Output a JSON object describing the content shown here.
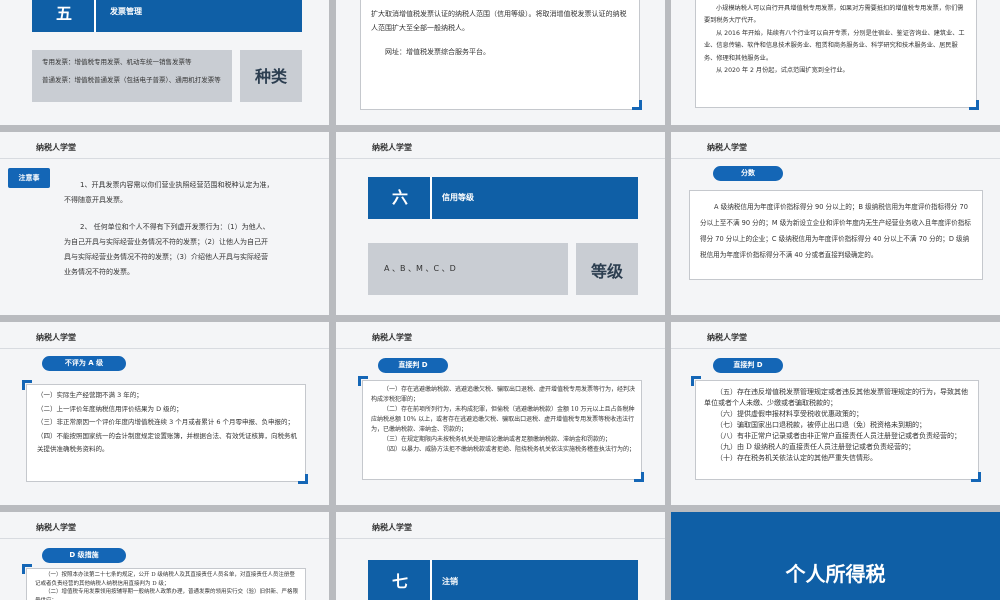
{
  "s1": {
    "number": "五",
    "title": "发票管理",
    "lines": [
      "专用发票：增值税专用发票、机动车统一销售发票等",
      "普通发票：增值税普通发票（包括电子普票）、通用机打发票等"
    ],
    "label": "种类"
  },
  "s2": {
    "p1": "扩大取消增值税发票认证的纳税人范围（信用等级）。将取消增值税发票认证的纳税人范围扩大至全部一般纳税人。",
    "p2": "网址：增值税发票综合服务平台。"
  },
  "s3": {
    "lines": [
      "小规模纳税人可以自行开具增值税专用发票，如果对方需要抵扣的增值税专用发票，你们需要到税务大厅代开。",
      "从 2016 年开始，陆续有八个行业可以自开专票，分别是住宿业、鉴证咨询业、建筑业、工业、信息传输、软件和信息技术服务业、租赁和商务服务业、科学研究和技术服务业、居民服务、修理和其他服务业。",
      "从 2020 年 2 月份起，试点范围扩宽到全行业。"
    ]
  },
  "s4": {
    "header": "纳税人学堂",
    "tag": "注意事",
    "p1": "1、开具发票内容需以你们营业执照经营范围和税种认定为准，不得随意开具发票。",
    "p2": "2、 任何单位和个人不得有下列虚开发票行为：（1）为他人、为自己开具与实际经营业务情况不符的发票；（2）让他人为自己开具与实际经营业务情况不符的发票；（3）介绍他人开具与实际经营业务情况不符的发票。"
  },
  "s5": {
    "header": "纳税人学堂",
    "number": "六",
    "title": "信用等级",
    "grades": "A 、B 、M 、C 、D",
    "label": "等级"
  },
  "s6": {
    "header": "纳税人学堂",
    "pill": "分数",
    "text": "A 级纳税信用为年度评价指标得分 90 分以上的；B 级纳税信用为年度评价指标得分 70 分以上至不满 90 分的；M 级为新设立企业和评价年度内无生产经营业务收入且年度评价指标得分 70 分以上的企业；C 级纳税信用为年度评价指标得分 40 分以上不满 70 分的；D 级纳税信用为年度评价指标得分不满 40 分或者直接判级确定的。"
  },
  "s7": {
    "header": "纳税人学堂",
    "pill": "不评为 A 级",
    "lines": [
      "（一）实际生产经营期不满 3 年的；",
      "（二）上一评价年度纳税信用评价结果为 D 级的；",
      "（三）非正常原因一个评价年度内增值税连续 3 个月或者累计 6 个月零申报、负申报的；",
      "（四）不能按照国家统一的会计制度规定设置账簿，并根据合法、有效凭证核算，向税务机关提供准确税务资料的。"
    ]
  },
  "s8": {
    "header": "纳税人学堂",
    "pill": "直接判 D",
    "lines": [
      "（一）存在逃避缴纳税款、逃避追缴欠税、骗取出口退税、虚开增值税专用发票等行为，经判决构成涉税犯罪的；",
      "（二）存在前项所列行为，未构成犯罪，但偷税（逃避缴纳税款）金额 10 万元以上且占各税种应纳税总额 10% 以上，或者存在逃避追缴欠税、骗取出口退税、虚开增值税专用发票等税收违法行为，已缴纳税款、滞纳金、罚款的；",
      "（三）在规定期限内未按税务机关处理结论缴纳或者足额缴纳税款、滞纳金和罚款的；",
      "（四）以暴力、威胁方法拒不缴纳税款或者拒绝、阻挠税务机关依法实施税务稽查执法行为的；"
    ]
  },
  "s9": {
    "header": "纳税人学堂",
    "pill": "直接判 D",
    "lines": [
      "（五）存在违反增值税发票管理规定或者违反其他发票管理规定的行为，导致其他单位或者个人未缴、少缴或者骗取税款的；",
      "（六）提供虚假申报材料享受税收优惠政策的；",
      "（七）骗取国家出口退税款，被停止出口退（免）税资格未到期的；",
      "（八）有非正常户记录或者由非正常户直接责任人员注册登记或者负责经营的；",
      "（九）由 D 级纳税人的直接责任人员注册登记或者负责经营的；",
      "（十）存在税务机关依法认定的其他严重失信情形。"
    ]
  },
  "s10": {
    "header": "纳税人学堂",
    "pill": "D 级措施",
    "lines": [
      "（一）按照本办法第二十七条的规定，公开 D 级纳税人及其直接责任人员名单，对直接责任人员注册登记或者负责经营的其他纳税人纳税信用直接判为 D 级；",
      "（二）增值税专用发票领用按辅导期一般纳税人政策办理，普通发票的领用实行交（验）旧供新、严格限量供应；"
    ]
  },
  "s11": {
    "header": "纳税人学堂",
    "number": "七",
    "title": "注销"
  },
  "s12": {
    "title": "个人所得税"
  }
}
